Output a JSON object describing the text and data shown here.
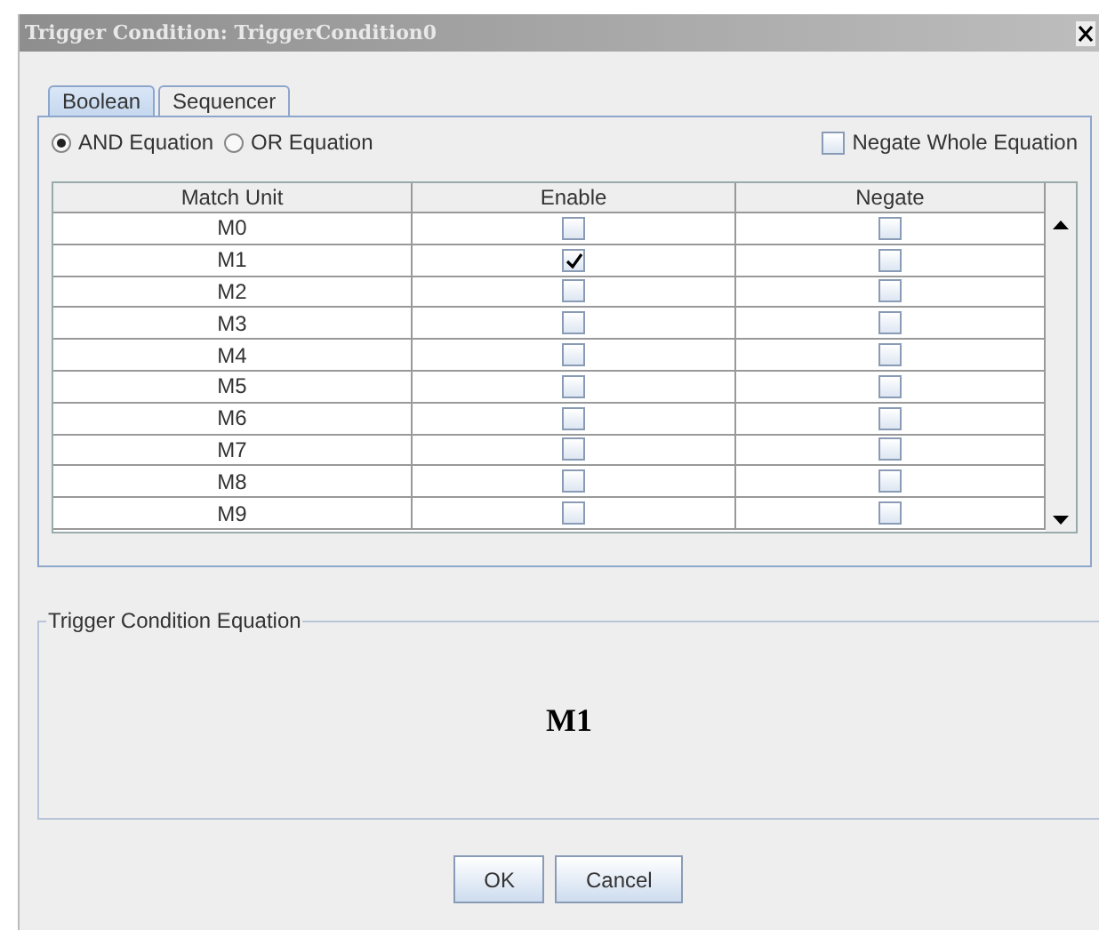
{
  "window": {
    "title": "Trigger Condition: TriggerCondition0"
  },
  "tabs": [
    {
      "label": "Boolean",
      "selected": true
    },
    {
      "label": "Sequencer",
      "selected": false
    }
  ],
  "equation_type": [
    {
      "label": "AND Equation",
      "selected": true
    },
    {
      "label": "OR Equation",
      "selected": false
    }
  ],
  "negate_whole": {
    "label": "Negate Whole Equation",
    "checked": false
  },
  "table": {
    "columns": [
      "Match Unit",
      "Enable",
      "Negate"
    ],
    "rows": [
      {
        "unit": "M0",
        "enable": false,
        "negate": false
      },
      {
        "unit": "M1",
        "enable": true,
        "negate": false
      },
      {
        "unit": "M2",
        "enable": false,
        "negate": false
      },
      {
        "unit": "M3",
        "enable": false,
        "negate": false
      },
      {
        "unit": "M4",
        "enable": false,
        "negate": false
      },
      {
        "unit": "M5",
        "enable": false,
        "negate": false
      },
      {
        "unit": "M6",
        "enable": false,
        "negate": false
      },
      {
        "unit": "M7",
        "enable": false,
        "negate": false
      },
      {
        "unit": "M8",
        "enable": false,
        "negate": false
      },
      {
        "unit": "M9",
        "enable": false,
        "negate": false
      }
    ]
  },
  "equation_group": {
    "title": "Trigger Condition Equation",
    "equation": "M1"
  },
  "buttons": [
    "OK",
    "Cancel"
  ]
}
